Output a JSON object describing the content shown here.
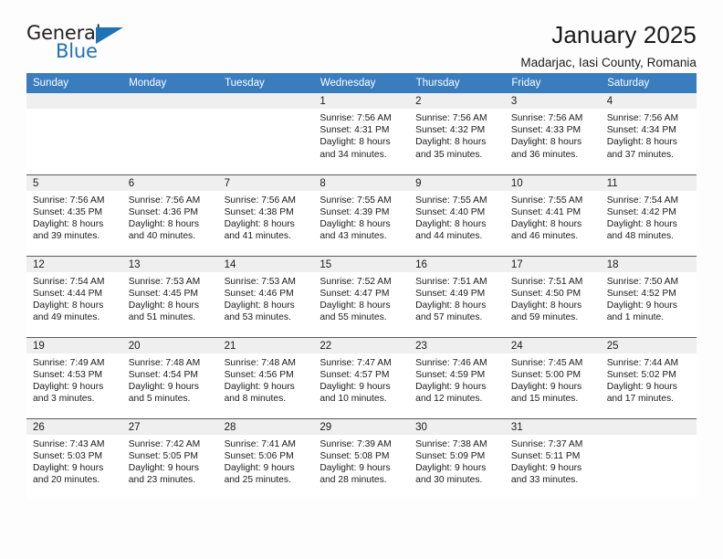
{
  "brand": {
    "name_part1": "General",
    "name_part2": "Blue",
    "accent_color": "#1d72b8"
  },
  "header": {
    "title": "January 2025",
    "subtitle": "Madarjac, Iasi County, Romania"
  },
  "calendar": {
    "header_bg": "#3a7dbf",
    "daynum_bg": "#efefef",
    "weekday_headers": [
      "Sunday",
      "Monday",
      "Tuesday",
      "Wednesday",
      "Thursday",
      "Friday",
      "Saturday"
    ],
    "weeks": [
      [
        {
          "day": "",
          "lines": []
        },
        {
          "day": "",
          "lines": []
        },
        {
          "day": "",
          "lines": []
        },
        {
          "day": "1",
          "lines": [
            "Sunrise: 7:56 AM",
            "Sunset: 4:31 PM",
            "Daylight: 8 hours",
            "and 34 minutes."
          ]
        },
        {
          "day": "2",
          "lines": [
            "Sunrise: 7:56 AM",
            "Sunset: 4:32 PM",
            "Daylight: 8 hours",
            "and 35 minutes."
          ]
        },
        {
          "day": "3",
          "lines": [
            "Sunrise: 7:56 AM",
            "Sunset: 4:33 PM",
            "Daylight: 8 hours",
            "and 36 minutes."
          ]
        },
        {
          "day": "4",
          "lines": [
            "Sunrise: 7:56 AM",
            "Sunset: 4:34 PM",
            "Daylight: 8 hours",
            "and 37 minutes."
          ]
        }
      ],
      [
        {
          "day": "5",
          "lines": [
            "Sunrise: 7:56 AM",
            "Sunset: 4:35 PM",
            "Daylight: 8 hours",
            "and 39 minutes."
          ]
        },
        {
          "day": "6",
          "lines": [
            "Sunrise: 7:56 AM",
            "Sunset: 4:36 PM",
            "Daylight: 8 hours",
            "and 40 minutes."
          ]
        },
        {
          "day": "7",
          "lines": [
            "Sunrise: 7:56 AM",
            "Sunset: 4:38 PM",
            "Daylight: 8 hours",
            "and 41 minutes."
          ]
        },
        {
          "day": "8",
          "lines": [
            "Sunrise: 7:55 AM",
            "Sunset: 4:39 PM",
            "Daylight: 8 hours",
            "and 43 minutes."
          ]
        },
        {
          "day": "9",
          "lines": [
            "Sunrise: 7:55 AM",
            "Sunset: 4:40 PM",
            "Daylight: 8 hours",
            "and 44 minutes."
          ]
        },
        {
          "day": "10",
          "lines": [
            "Sunrise: 7:55 AM",
            "Sunset: 4:41 PM",
            "Daylight: 8 hours",
            "and 46 minutes."
          ]
        },
        {
          "day": "11",
          "lines": [
            "Sunrise: 7:54 AM",
            "Sunset: 4:42 PM",
            "Daylight: 8 hours",
            "and 48 minutes."
          ]
        }
      ],
      [
        {
          "day": "12",
          "lines": [
            "Sunrise: 7:54 AM",
            "Sunset: 4:44 PM",
            "Daylight: 8 hours",
            "and 49 minutes."
          ]
        },
        {
          "day": "13",
          "lines": [
            "Sunrise: 7:53 AM",
            "Sunset: 4:45 PM",
            "Daylight: 8 hours",
            "and 51 minutes."
          ]
        },
        {
          "day": "14",
          "lines": [
            "Sunrise: 7:53 AM",
            "Sunset: 4:46 PM",
            "Daylight: 8 hours",
            "and 53 minutes."
          ]
        },
        {
          "day": "15",
          "lines": [
            "Sunrise: 7:52 AM",
            "Sunset: 4:47 PM",
            "Daylight: 8 hours",
            "and 55 minutes."
          ]
        },
        {
          "day": "16",
          "lines": [
            "Sunrise: 7:51 AM",
            "Sunset: 4:49 PM",
            "Daylight: 8 hours",
            "and 57 minutes."
          ]
        },
        {
          "day": "17",
          "lines": [
            "Sunrise: 7:51 AM",
            "Sunset: 4:50 PM",
            "Daylight: 8 hours",
            "and 59 minutes."
          ]
        },
        {
          "day": "18",
          "lines": [
            "Sunrise: 7:50 AM",
            "Sunset: 4:52 PM",
            "Daylight: 9 hours",
            "and 1 minute."
          ]
        }
      ],
      [
        {
          "day": "19",
          "lines": [
            "Sunrise: 7:49 AM",
            "Sunset: 4:53 PM",
            "Daylight: 9 hours",
            "and 3 minutes."
          ]
        },
        {
          "day": "20",
          "lines": [
            "Sunrise: 7:48 AM",
            "Sunset: 4:54 PM",
            "Daylight: 9 hours",
            "and 5 minutes."
          ]
        },
        {
          "day": "21",
          "lines": [
            "Sunrise: 7:48 AM",
            "Sunset: 4:56 PM",
            "Daylight: 9 hours",
            "and 8 minutes."
          ]
        },
        {
          "day": "22",
          "lines": [
            "Sunrise: 7:47 AM",
            "Sunset: 4:57 PM",
            "Daylight: 9 hours",
            "and 10 minutes."
          ]
        },
        {
          "day": "23",
          "lines": [
            "Sunrise: 7:46 AM",
            "Sunset: 4:59 PM",
            "Daylight: 9 hours",
            "and 12 minutes."
          ]
        },
        {
          "day": "24",
          "lines": [
            "Sunrise: 7:45 AM",
            "Sunset: 5:00 PM",
            "Daylight: 9 hours",
            "and 15 minutes."
          ]
        },
        {
          "day": "25",
          "lines": [
            "Sunrise: 7:44 AM",
            "Sunset: 5:02 PM",
            "Daylight: 9 hours",
            "and 17 minutes."
          ]
        }
      ],
      [
        {
          "day": "26",
          "lines": [
            "Sunrise: 7:43 AM",
            "Sunset: 5:03 PM",
            "Daylight: 9 hours",
            "and 20 minutes."
          ]
        },
        {
          "day": "27",
          "lines": [
            "Sunrise: 7:42 AM",
            "Sunset: 5:05 PM",
            "Daylight: 9 hours",
            "and 23 minutes."
          ]
        },
        {
          "day": "28",
          "lines": [
            "Sunrise: 7:41 AM",
            "Sunset: 5:06 PM",
            "Daylight: 9 hours",
            "and 25 minutes."
          ]
        },
        {
          "day": "29",
          "lines": [
            "Sunrise: 7:39 AM",
            "Sunset: 5:08 PM",
            "Daylight: 9 hours",
            "and 28 minutes."
          ]
        },
        {
          "day": "30",
          "lines": [
            "Sunrise: 7:38 AM",
            "Sunset: 5:09 PM",
            "Daylight: 9 hours",
            "and 30 minutes."
          ]
        },
        {
          "day": "31",
          "lines": [
            "Sunrise: 7:37 AM",
            "Sunset: 5:11 PM",
            "Daylight: 9 hours",
            "and 33 minutes."
          ]
        },
        {
          "day": "",
          "lines": []
        }
      ]
    ]
  }
}
